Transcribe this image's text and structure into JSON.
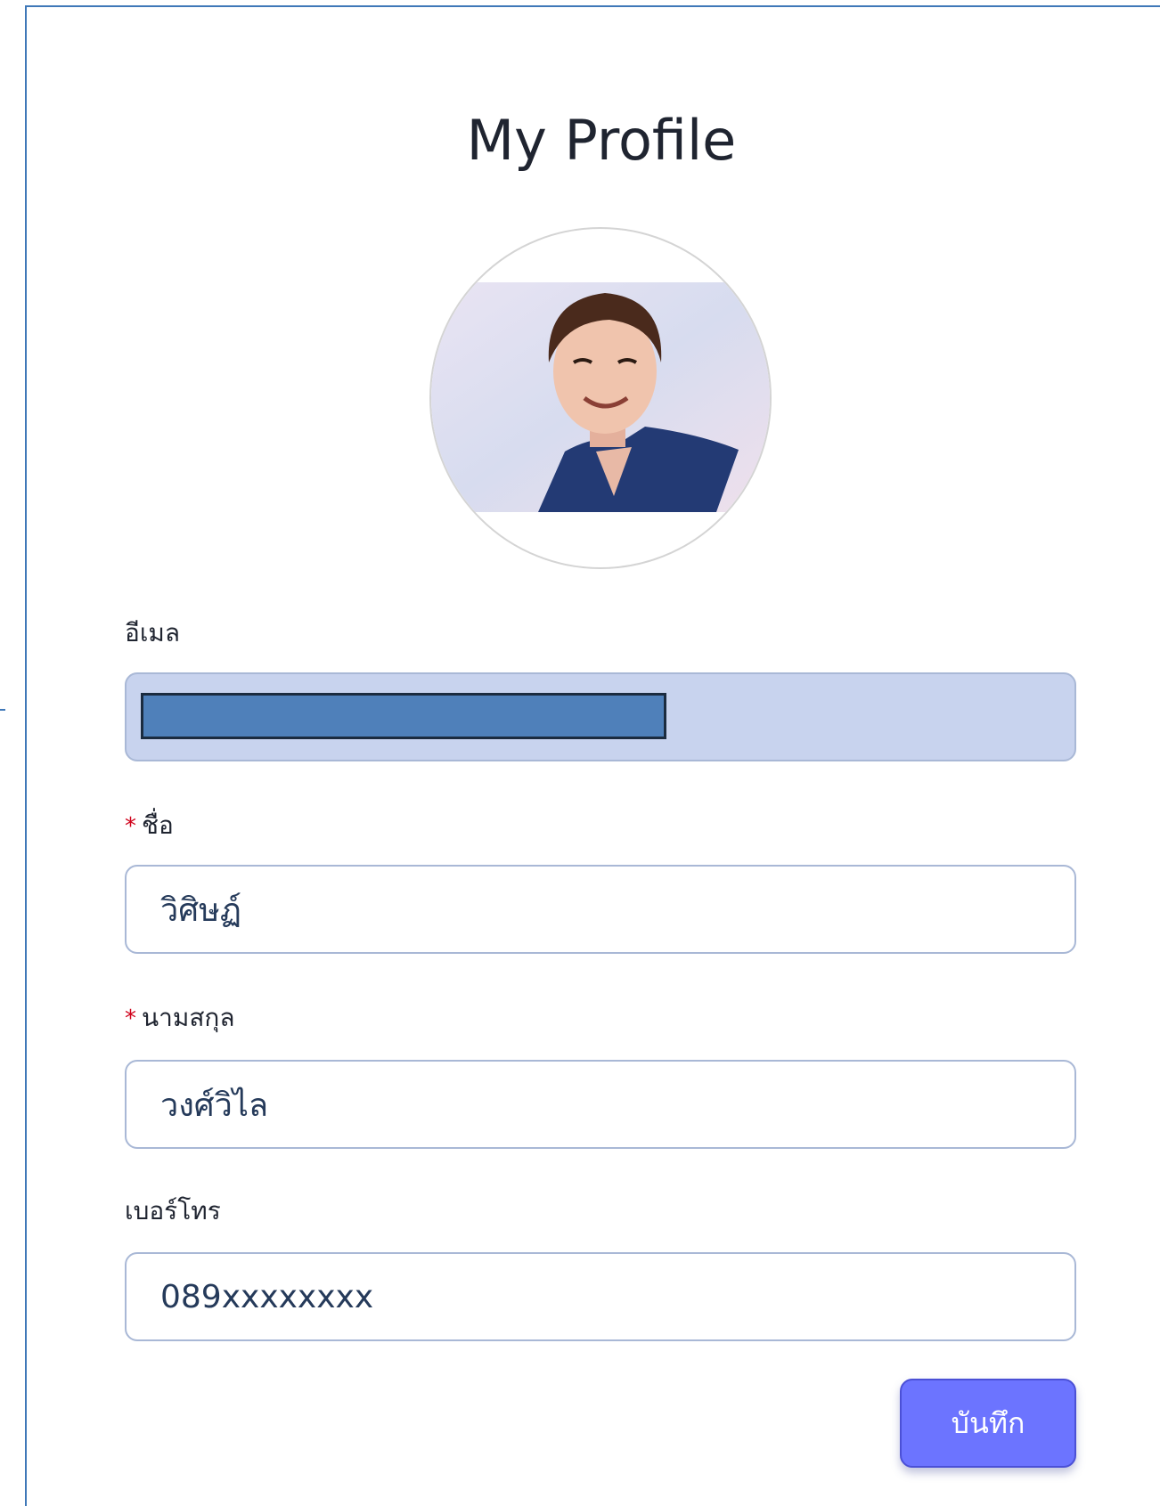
{
  "page": {
    "title": "My Profile"
  },
  "avatar": {
    "icon": "profile-photo"
  },
  "form": {
    "email": {
      "label": "อีเมล",
      "value": ""
    },
    "first_name": {
      "required_mark": "*",
      "label": "ชื่อ",
      "value": "วิศิษฏ์"
    },
    "last_name": {
      "required_mark": "*",
      "label": "นามสกุล",
      "value": "วงศ์วิไล"
    },
    "phone": {
      "label": "เบอร์โทร",
      "value": "089xxxxxxxx"
    }
  },
  "actions": {
    "save_label": "บันทึก"
  },
  "colors": {
    "frame_border": "#3f78b8",
    "input_border": "#a9b8d6",
    "disabled_input_bg": "#c8d3ee",
    "required_mark": "#d0021b",
    "button_bg": "#6c74ff",
    "redaction_fill": "#4f80ba"
  }
}
